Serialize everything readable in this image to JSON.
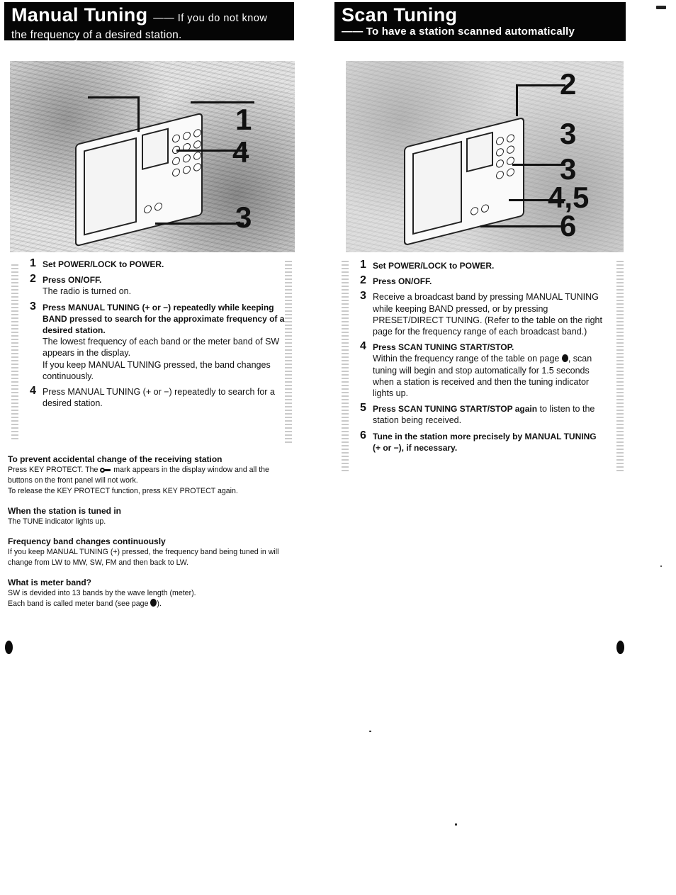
{
  "left_page": {
    "title": {
      "main": "Manual Tuning",
      "dash_sub": "—— If you do not know",
      "sub": "the frequency of a desired station."
    },
    "illustration": {
      "icon": "radio-device-illustration",
      "callouts": [
        "1",
        "4",
        "3"
      ]
    },
    "steps": [
      {
        "num": "1",
        "head": "Set POWER/LOCK to POWER.",
        "body": []
      },
      {
        "num": "2",
        "head": "Press ON/OFF.",
        "body": [
          "The radio is turned on."
        ]
      },
      {
        "num": "3",
        "head": "Press MANUAL TUNING (+ or −) repeatedly while keeping BAND pressed to search for the approximate frequency of a desired station.",
        "body": [
          "The lowest frequency of each band or the meter band of SW appears in the display.",
          "If you keep MANUAL TUNING pressed, the band changes continuously."
        ]
      },
      {
        "num": "4",
        "head": "",
        "body": [
          "Press MANUAL TUNING (+ or −) repeatedly to search for a desired station."
        ]
      }
    ],
    "notes": [
      {
        "head": "To prevent accidental change of the receiving station",
        "body_before_icon": "Press KEY PROTECT. The",
        "icon": "key-icon",
        "body_after_icon": "mark appears in the display window and all the buttons on the front panel will not work.",
        "body_2": "To release the KEY PROTECT function, press KEY PROTECT again."
      },
      {
        "head": "When the station is tuned in",
        "body": "The TUNE indicator lights up."
      },
      {
        "head": "Frequency band changes continuously",
        "body": "If you keep MANUAL TUNING (+) pressed, the frequency band being tuned in will change from LW to MW, SW, FM and then back to LW."
      },
      {
        "head": "What is meter band?",
        "body": "SW is devided into 13 bands by the wave length (meter).",
        "body_2_before": "Each band is called meter band (see page",
        "body_2_after": ")."
      }
    ]
  },
  "right_page": {
    "title": {
      "main": "Scan Tuning",
      "sub": "—— To have a station scanned automatically"
    },
    "illustration": {
      "icon": "radio-device-illustration",
      "callouts": [
        "2",
        "3",
        "3",
        "4,5",
        "6"
      ]
    },
    "steps": [
      {
        "num": "1",
        "head": "Set POWER/LOCK to POWER.",
        "body": []
      },
      {
        "num": "2",
        "head": "Press ON/OFF.",
        "body": []
      },
      {
        "num": "3",
        "head": "",
        "body": [
          "Receive a broadcast band by pressing MANUAL TUNING while keeping BAND pressed, or by pressing PRESET/DIRECT TUNING. (Refer to the table on the right page for the frequency range of each broadcast band.)"
        ]
      },
      {
        "num": "4",
        "head": "Press SCAN TUNING START/STOP.",
        "body_before_dot": "Within the frequency range of the table on page",
        "body_after_dot": ", scan tuning will begin and stop automatically for 1.5 seconds when a station is received and then the tuning indicator lights up."
      },
      {
        "num": "5",
        "head": "Press SCAN TUNING START/STOP again",
        "tail": " to listen to the station being received."
      },
      {
        "num": "6",
        "head": "Tune in the station more precisely by MANUAL TUNING (+ or −), if necessary.",
        "body": []
      }
    ]
  },
  "page_markers": [
    "page-bullet-left",
    "page-bullet-right"
  ]
}
